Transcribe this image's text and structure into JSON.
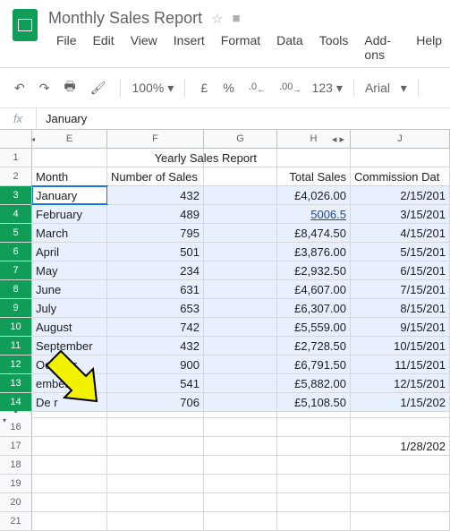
{
  "doc": {
    "title": "Monthly Sales Report"
  },
  "menus": {
    "file": "File",
    "edit": "Edit",
    "view": "View",
    "insert": "Insert",
    "format": "Format",
    "data": "Data",
    "tools": "Tools",
    "addons": "Add-ons",
    "help": "Help"
  },
  "toolbar": {
    "zoom": "100%",
    "currency": "£",
    "percent": "%",
    "dec_dec": ".0",
    "dec_inc": ".00",
    "more_fmt": "123",
    "font": "Arial"
  },
  "formula": {
    "label": "fx",
    "value": "January"
  },
  "columns": {
    "E": "E",
    "F": "F",
    "G": "G",
    "H": "H",
    "J": "J"
  },
  "headers": {
    "report_title": "Yearly Sales Report",
    "month": "Month",
    "num_sales": "Number of Sales",
    "total_sales": "Total Sales",
    "commission_date": "Commission Dat"
  },
  "rows": [
    {
      "n": "3",
      "month": "January",
      "num": "432",
      "total": "£4,026.00",
      "date": "2/15/201"
    },
    {
      "n": "4",
      "month": "February",
      "num": "489",
      "total": "5006.5",
      "date": "3/15/201",
      "link": true
    },
    {
      "n": "5",
      "month": "March",
      "num": "795",
      "total": "£8,474.50",
      "date": "4/15/201"
    },
    {
      "n": "6",
      "month": "April",
      "num": "501",
      "total": "£3,876.00",
      "date": "5/15/201"
    },
    {
      "n": "7",
      "month": "May",
      "num": "234",
      "total": "£2,932.50",
      "date": "6/15/201"
    },
    {
      "n": "8",
      "month": "June",
      "num": "631",
      "total": "£4,607.00",
      "date": "7/15/201"
    },
    {
      "n": "9",
      "month": "July",
      "num": "653",
      "total": "£6,307.00",
      "date": "8/15/201"
    },
    {
      "n": "10",
      "month": "August",
      "num": "742",
      "total": "£5,559.00",
      "date": "9/15/201"
    },
    {
      "n": "11",
      "month": "September",
      "num": "432",
      "total": "£2,728.50",
      "date": "10/15/201"
    },
    {
      "n": "12",
      "month": "October",
      "num": "900",
      "total": "£6,791.50",
      "date": "11/15/201"
    },
    {
      "n": "13",
      "month": "   ember",
      "num": "541",
      "total": "£5,882.00",
      "date": "12/15/201"
    },
    {
      "n": "14",
      "month": "De      r",
      "num": "706",
      "total": "£5,108.50",
      "date": "1/15/202"
    }
  ],
  "extra_rows": {
    "r16": "16",
    "r17": "17",
    "r18": "18",
    "r19": "19",
    "r20": "20",
    "r21": "21",
    "r17_date": "1/28/202"
  },
  "chart_data": {
    "type": "table",
    "title": "Yearly Sales Report",
    "columns": [
      "Month",
      "Number of Sales",
      "Total Sales",
      "Commission Date"
    ],
    "rows": [
      [
        "January",
        432,
        4026.0,
        "2/15/201"
      ],
      [
        "February",
        489,
        5006.5,
        "3/15/201"
      ],
      [
        "March",
        795,
        8474.5,
        "4/15/201"
      ],
      [
        "April",
        501,
        3876.0,
        "5/15/201"
      ],
      [
        "May",
        234,
        2932.5,
        "6/15/201"
      ],
      [
        "June",
        631,
        4607.0,
        "7/15/201"
      ],
      [
        "July",
        653,
        6307.0,
        "8/15/201"
      ],
      [
        "August",
        742,
        5559.0,
        "9/15/201"
      ],
      [
        "September",
        432,
        2728.5,
        "10/15/201"
      ],
      [
        "October",
        900,
        6791.5,
        "11/15/201"
      ],
      [
        "November",
        541,
        5882.0,
        "12/15/201"
      ],
      [
        "December",
        706,
        5108.5,
        "1/15/202"
      ]
    ],
    "currency": "GBP"
  }
}
